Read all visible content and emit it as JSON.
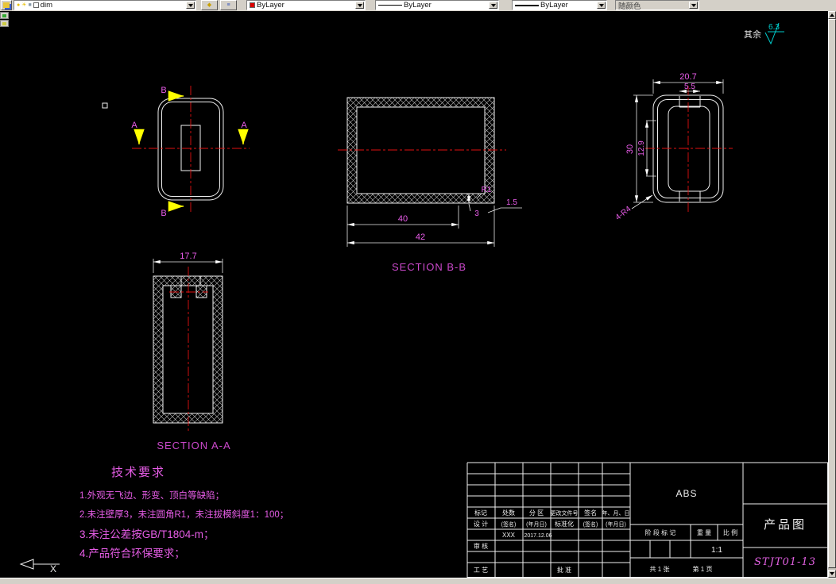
{
  "toolbar": {
    "layer_value": "dim",
    "color_value": "ByLayer",
    "linetype_value": "ByLayer",
    "lineweight_value": "ByLayer",
    "plotstyle_value": "随颜色"
  },
  "drawing": {
    "surface_note": {
      "prefix": "其余",
      "roughness": "6.3"
    },
    "front_view": {
      "marker_a": "A",
      "marker_b": "B"
    },
    "section_bb": {
      "label": "SECTION B-B",
      "dim_inner": "40",
      "dim_outer": "42",
      "dim_wall": "1.5",
      "dim_bottom": "3",
      "dim_radius": "R1"
    },
    "side_view": {
      "dim_width": "20.7",
      "dim_notch": "5.5",
      "dim_height": "30",
      "dim_inner_height": "12.9",
      "dim_corner": "4-R4"
    },
    "section_aa": {
      "label": "SECTION A-A",
      "dim_width": "17.7"
    },
    "tech_req": {
      "title": "技术要求",
      "line1": "1.外观无飞边、形变、顶白等缺陷；",
      "line2": "2.未注壁厚3，未注圆角R1，未注拔模斜度1：100；",
      "line3": "3.未注公差按GB/T1804-m；",
      "line4": "4.产品符合环保要求；"
    },
    "ucs_x": "X"
  },
  "title_block": {
    "material": "ABS",
    "product_title": "产品图",
    "drawing_no": "STJT01-13",
    "header_mark": "标记",
    "header_count": "处数",
    "header_zone": "分 区",
    "header_change": "更改文件号",
    "header_sign": "签名",
    "header_date": "年、月、日",
    "design": "设 计",
    "sign_ph": "(签名)",
    "date_ph": "(年月日)",
    "standardize": "标准化",
    "designer_name": "XXX",
    "design_date": "2017.12.06",
    "review": "审 核",
    "process": "工 艺",
    "approve": "批 准",
    "stage_mark": "阶 段 标 记",
    "weight": "重 量",
    "scale_label": "比 例",
    "scale_value": "1:1",
    "sheet_total": "共 1 张",
    "sheet_page": "第 1 页"
  }
}
